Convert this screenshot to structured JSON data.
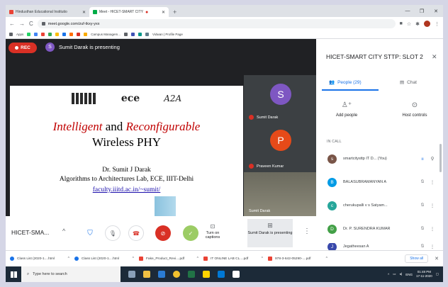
{
  "browser": {
    "tabs": [
      {
        "label": "Hindusthan Educational Institutio"
      },
      {
        "label": "Meet - HICET-SMART CITY"
      }
    ],
    "url": "meet.google.com/zuf-tkxy-yxx",
    "bookmarks": [
      "Apps",
      "Campus Managem...",
      "Vidwan | Profile Page"
    ]
  },
  "meet": {
    "rec_label": "REC",
    "presenter_initial": "S",
    "presenting_text": "Sumit Darak is presenting",
    "meeting_name": "HICET-SMA...",
    "captions_label": "Turn on captions",
    "present_label": "Sumit Darak is presenting",
    "tiles": [
      {
        "initial": "S",
        "name": "Sumit Darak",
        "color": "#7e57c2"
      },
      {
        "initial": "P",
        "name": "Praveen Kumar",
        "color": "#e64a19"
      },
      {
        "name": "Sumit Darak"
      }
    ]
  },
  "slide": {
    "logo_mid": "ece",
    "logo_right": "A2A",
    "title_red1": "Intelligent",
    "title_and": "and",
    "title_red2": "Reconfigurable",
    "title_line2": "Wireless PHY",
    "author": "Dr. Sumit J Darak",
    "affiliation": "Algorithms to Architectures Lab, ECE, IIIT-Delhi",
    "url": "faculty.iiitd.ac.in/~sumit/"
  },
  "panel": {
    "title": "HICET-SMART CITY STTP: SLOT 2",
    "tab_people": "People (29)",
    "tab_chat": "Chat",
    "add_people": "Add people",
    "host_controls": "Host controls",
    "in_call": "IN CALL",
    "participants": [
      {
        "initial": "s",
        "name": "smartcitysttp IT D...  (You)",
        "color": "#795548"
      },
      {
        "initial": "B",
        "name": "BALASUBRAMANYAN A",
        "color": "#039be5"
      },
      {
        "initial": "c",
        "name": "cherukupalli v s Satyam...",
        "color": "#26a69a"
      },
      {
        "initial": "D",
        "name": "Dr. P. SURENDRA KUMAR",
        "color": "#43a047"
      },
      {
        "initial": "J",
        "name": "Jegatheesan A",
        "color": "#3949ab"
      }
    ]
  },
  "downloads": {
    "items": [
      {
        "name": "Class List (2020-1....html",
        "type": "html"
      },
      {
        "name": "Class List (2020-1....html",
        "type": "html"
      },
      {
        "name": "Fake_Product_Revi....pdf",
        "type": "pdf"
      },
      {
        "name": "IT ONLINE LAB CL....pdf",
        "type": "pdf"
      },
      {
        "name": "978-3-642-05290-....pdf",
        "type": "pdf"
      }
    ],
    "show_all": "Show all"
  },
  "taskbar": {
    "search_placeholder": "Type here to search",
    "lang": "ENG",
    "time": "01:48 PM",
    "date": "17-11-2020"
  }
}
